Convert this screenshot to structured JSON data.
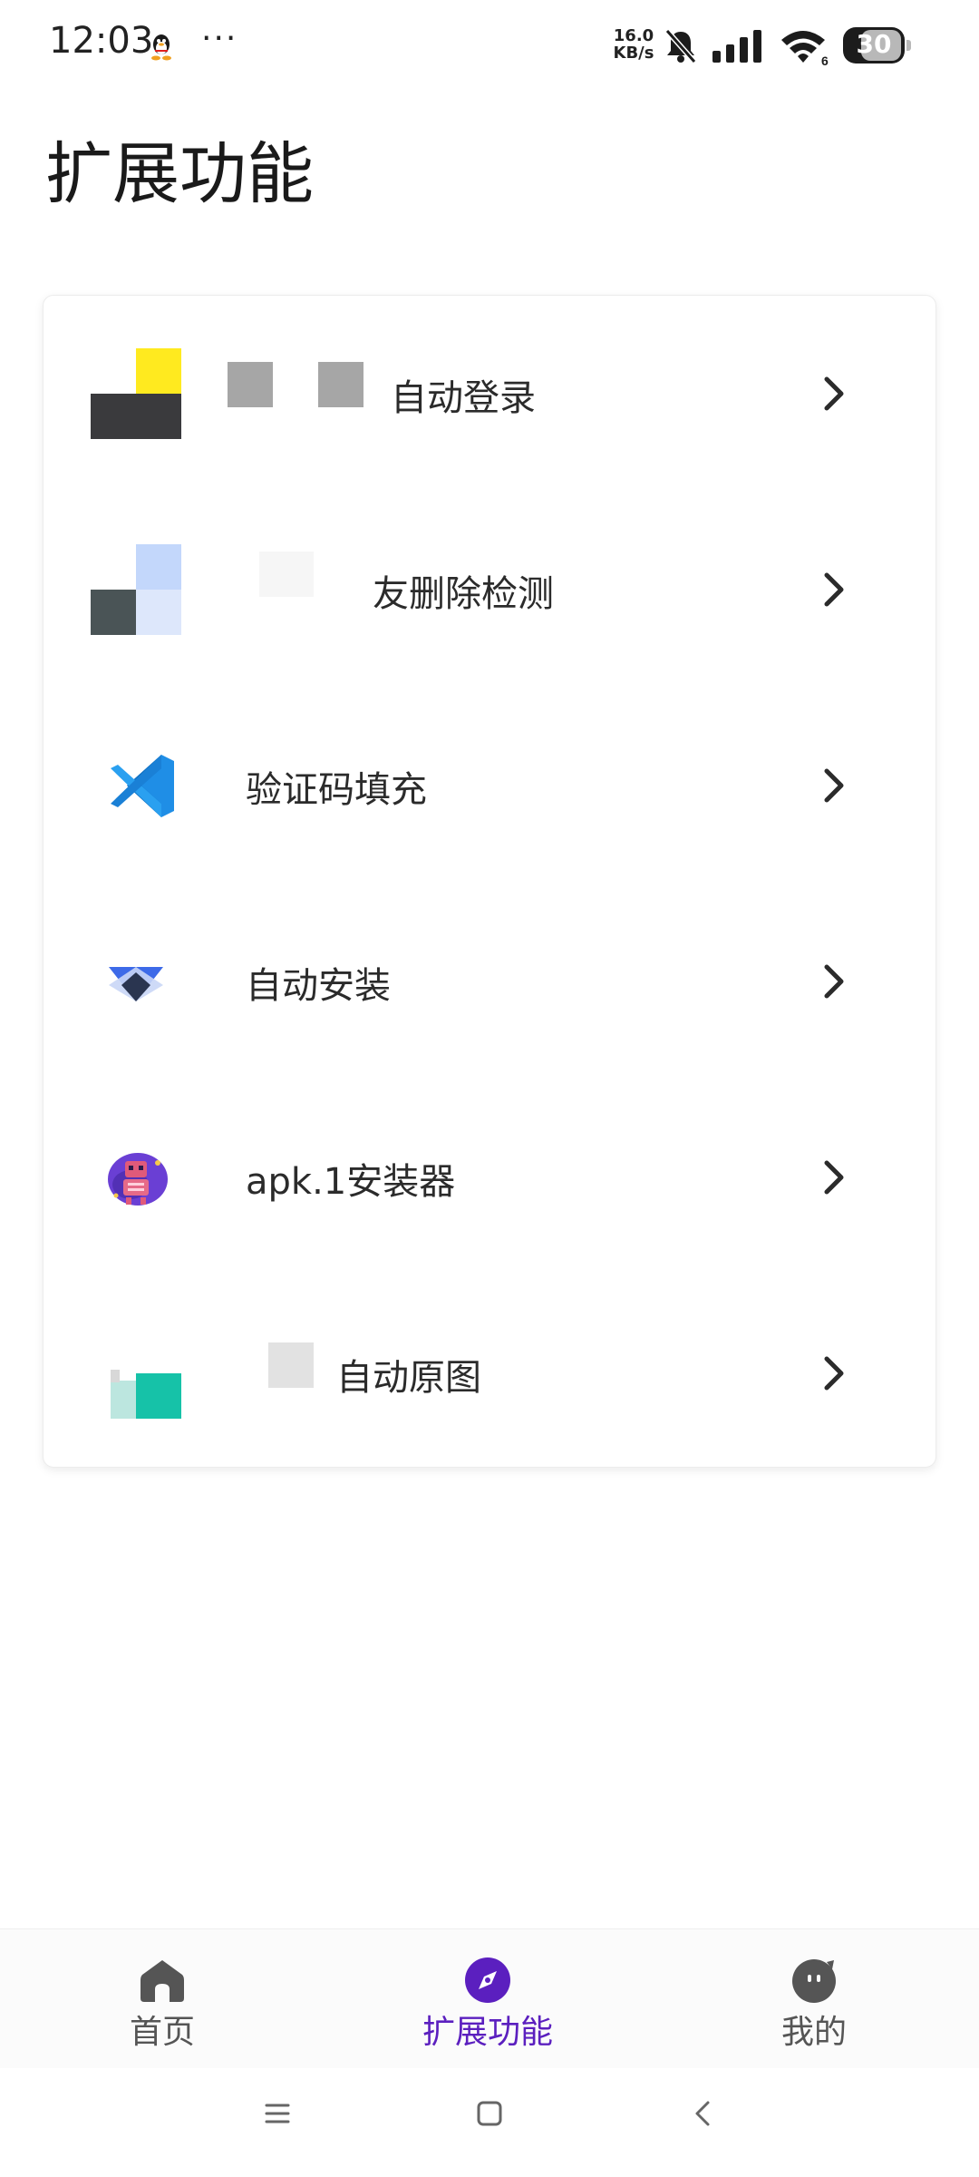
{
  "status_bar": {
    "time": "12:03",
    "more_indicator": "···",
    "net_speed_value": "16.0",
    "net_speed_unit": "KB/s",
    "wifi_generation": "6",
    "battery_level": "30",
    "icons": [
      "qq-penguin-icon",
      "bell-off-icon",
      "signal-icon",
      "wifi-icon",
      "battery-icon"
    ]
  },
  "page": {
    "title": "扩展功能"
  },
  "features": [
    {
      "label": "自动登录",
      "icon": "redacted-app-icon"
    },
    {
      "label": "友删除检测",
      "icon": "redacted-app-icon"
    },
    {
      "label": "验证码填充",
      "icon": "vscode-style-icon"
    },
    {
      "label": "自动安装",
      "icon": "triangle-install-icon"
    },
    {
      "label": "apk.1安装器",
      "icon": "robot-installer-icon"
    },
    {
      "label": "自动原图",
      "icon": "redacted-app-icon"
    }
  ],
  "bottom_nav": {
    "items": [
      {
        "label": "首页",
        "icon": "home-icon",
        "active": false
      },
      {
        "label": "扩展功能",
        "icon": "compass-icon",
        "active": true
      },
      {
        "label": "我的",
        "icon": "profile-icon",
        "active": false
      }
    ],
    "active_color": "#5b1fbf",
    "inactive_color": "#555555"
  },
  "system_nav": [
    "menu-icon",
    "home-square-icon",
    "back-icon"
  ]
}
